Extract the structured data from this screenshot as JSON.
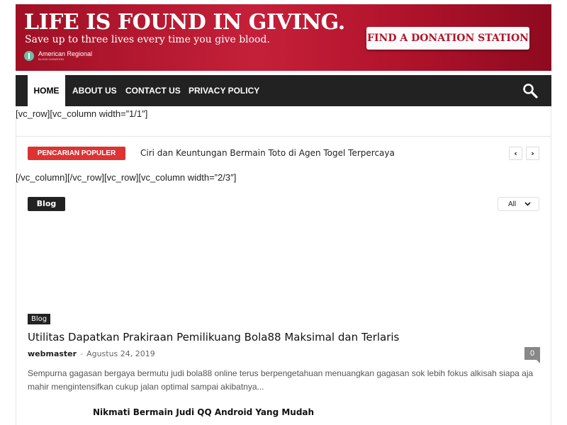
{
  "banner": {
    "headline": "LIFE IS FOUND IN GIVING.",
    "subheadline": "Save up to three lives every time you give blood.",
    "org_name": "American Regional",
    "org_tagline": "BLOOD DONATION",
    "cta_label": "FIND A DONATION STATION",
    "colors": {
      "background": "#b3142d",
      "cta_text": "#b3142d"
    }
  },
  "nav": {
    "items": [
      {
        "label": "HOME",
        "active": true
      },
      {
        "label": "ABOUT US",
        "active": false
      },
      {
        "label": "CONTACT US",
        "active": false
      },
      {
        "label": "PRIVACY POLICY",
        "active": false
      }
    ],
    "search_icon": "search-icon",
    "background": "#222222"
  },
  "shortcodes": {
    "row_open": "[vc_row][vc_column width=”1/1″]",
    "row_close": "[/vc_column][/vc_row][vc_row][vc_column width=”2/3″]"
  },
  "trending": {
    "label": "PENCARIAN POPULER",
    "headline": "Ciri dan Keuntungan Bermain Toto di Agen Togel Terpercaya",
    "prev_icon": "chevron-left-icon",
    "next_icon": "chevron-right-icon",
    "accent": "#dd3333"
  },
  "block": {
    "title": "Blog",
    "filter_value": "All",
    "filter_icon": "chevron-down-icon"
  },
  "article": {
    "category": "Blog",
    "title": "Utilitas Dapatkan Prakiraan Pemilikuang Bola88 Maksimal dan Terlaris",
    "author": "webmaster",
    "separator": "-",
    "date": "Agustus 24, 2019",
    "comments": "0",
    "excerpt": "Sempurna gagasan bergaya bermutu judi bola88 online terus berpengetahuan menuangkan gagasan sok lebih fokus alkisah siapa aja mahir mengintensifkan cukup jalan optimal sampai akibatnya..."
  },
  "next_article": {
    "title": "Nikmati Bermain Judi QQ Android Yang Mudah"
  }
}
